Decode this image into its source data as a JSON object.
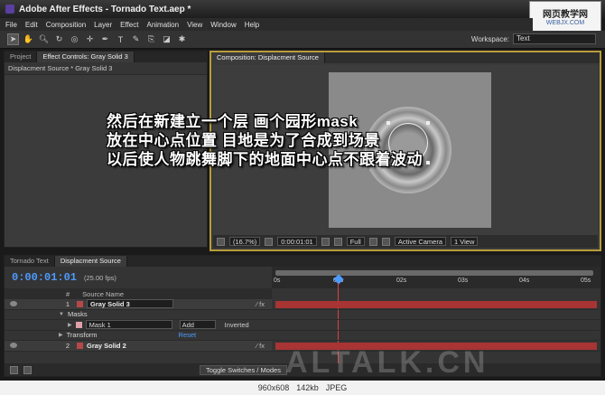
{
  "window": {
    "title": "Adobe After Effects - Tornado Text.aep *"
  },
  "watermark": {
    "main": "网页教学网",
    "sub": "WEBJX.COM",
    "big": "ALTALK.CN"
  },
  "menu": [
    "File",
    "Edit",
    "Composition",
    "Layer",
    "Effect",
    "Animation",
    "View",
    "Window",
    "Help"
  ],
  "toolbar": {
    "tools": [
      "arrow-tool",
      "hand-tool",
      "zoom-tool",
      "rotate-tool",
      "camera-tool",
      "pan-behind-tool",
      "pen-tool",
      "type-tool",
      "brush-tool",
      "clone-tool",
      "eraser-tool",
      "puppet-tool"
    ],
    "workspace_label": "Workspace:",
    "workspace_value": "Text"
  },
  "left_panel": {
    "tabs": [
      "Project",
      "Effect Controls: Gray Solid 3"
    ],
    "subhead": "Displacment Source * Gray Solid 3"
  },
  "comp_panel": {
    "tab": "Composition: Displacment Source",
    "footer": {
      "zoom": "(16.7%)",
      "time": "0:00:01:01",
      "resolution": "Full",
      "camera": "Active Camera",
      "view": "1 View"
    }
  },
  "overlay": {
    "lines": [
      "然后在新建立一个层  画个园形mask",
      "放在中心点位置  目地是为了合成到场景",
      "以后使人物跳舞脚下的地面中心点不跟着波动"
    ]
  },
  "timeline": {
    "tabs": [
      "Tornado Text",
      "Displacment Source"
    ],
    "timecode": "0:00:01:01",
    "fps": "(25.00 fps)",
    "ruler_ticks": [
      "0s",
      "01s",
      "02s",
      "03s",
      "04s",
      "05s"
    ],
    "col_num": "#",
    "col_source": "Source Name",
    "rows": {
      "l1_num": "1",
      "l1_name": "Gray Solid 3",
      "masks": "Masks",
      "mask1": "Mask 1",
      "mask1_mode": "Add",
      "mask1_inverted": "Inverted",
      "transform": "Transform",
      "reset": "Reset",
      "l2_num": "2",
      "l2_name": "Gray Solid 2"
    },
    "toggle_label": "Toggle Switches / Modes"
  },
  "status": {
    "dims": "960x608",
    "size": "142kb",
    "format": "JPEG"
  }
}
